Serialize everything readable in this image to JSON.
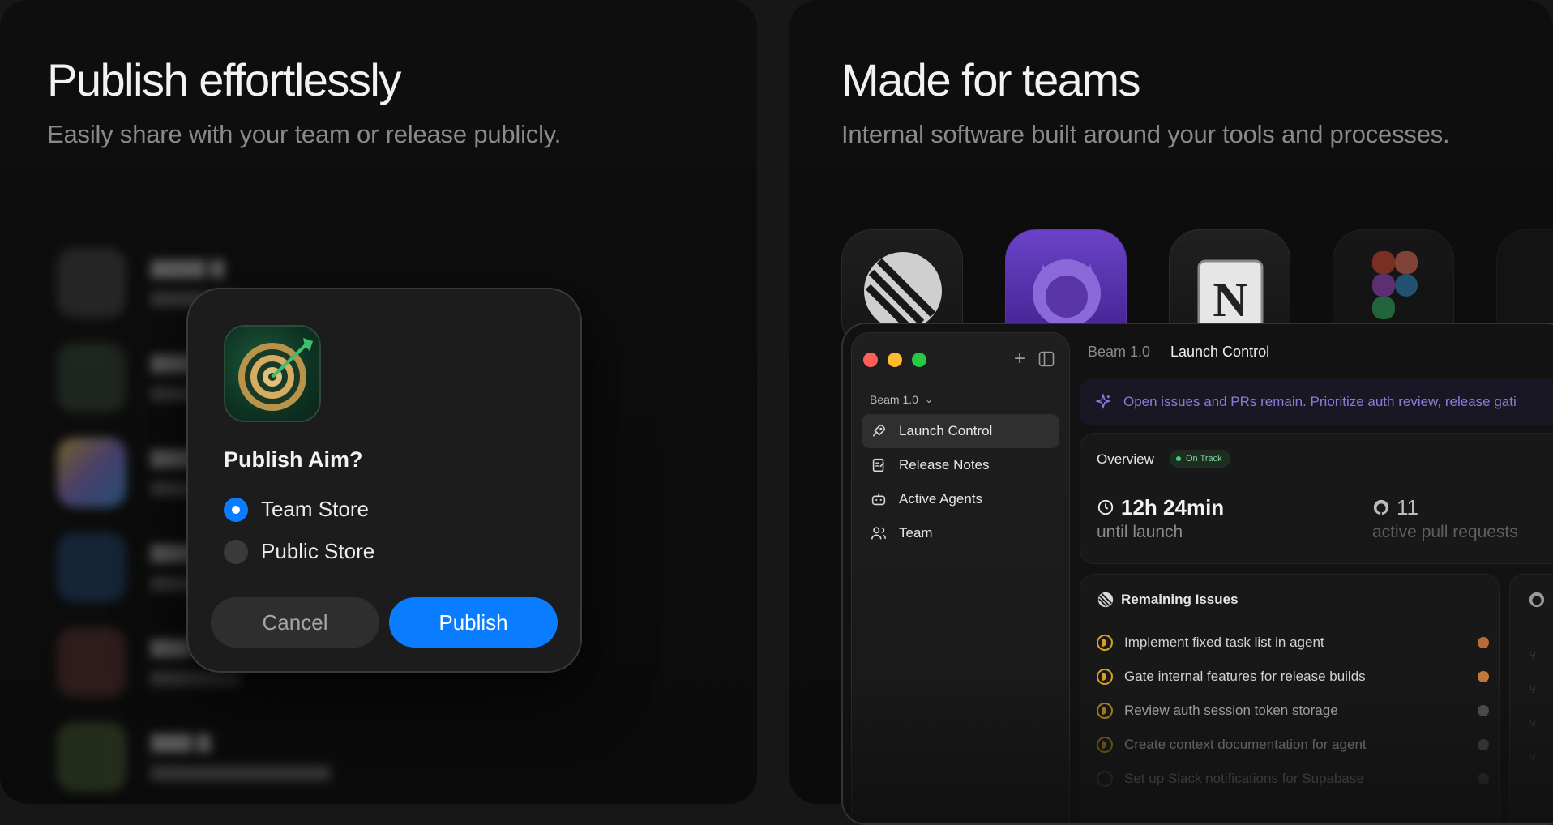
{
  "left_panel": {
    "headline": "Publish effortlessly",
    "subhead": "Easily share with your team or release publicly."
  },
  "dialog": {
    "title": "Publish Aim?",
    "options": [
      {
        "label": "Team Store",
        "selected": true
      },
      {
        "label": "Public Store",
        "selected": false
      }
    ],
    "cancel_label": "Cancel",
    "publish_label": "Publish",
    "accent": "#0a7cff"
  },
  "right_panel": {
    "headline": "Made for teams",
    "subhead": "Internal software built around your tools and processes.",
    "tool_icons": [
      "linear-icon",
      "github-icon",
      "notion-icon",
      "figma-icon"
    ]
  },
  "app": {
    "workspace": "Beam 1.0",
    "breadcrumb": {
      "parent": "Beam 1.0",
      "current": "Launch Control"
    },
    "sidebar": [
      {
        "label": "Launch Control",
        "icon": "rocket-icon",
        "active": true
      },
      {
        "label": "Release Notes",
        "icon": "notes-icon",
        "active": false
      },
      {
        "label": "Active Agents",
        "icon": "robot-icon",
        "active": false
      },
      {
        "label": "Team",
        "icon": "users-icon",
        "active": false
      }
    ],
    "banner": "Open issues and PRs remain. Prioritize auth review, release gati",
    "overview": {
      "title": "Overview",
      "status": "On Track",
      "stat1_value": "12h 24min",
      "stat1_label": "until launch",
      "stat2_value": "11",
      "stat2_label": "active pull requests"
    },
    "issues": {
      "title": "Remaining Issues",
      "items": [
        {
          "label": "Implement fixed task list in agent",
          "state": "in-progress"
        },
        {
          "label": "Gate internal features for release builds",
          "state": "in-progress"
        },
        {
          "label": "Review auth session token storage",
          "state": "in-progress"
        },
        {
          "label": "Create context documentation for agent",
          "state": "in-progress"
        },
        {
          "label": "Set up Slack notifications for Supabase",
          "state": "todo"
        }
      ]
    }
  }
}
